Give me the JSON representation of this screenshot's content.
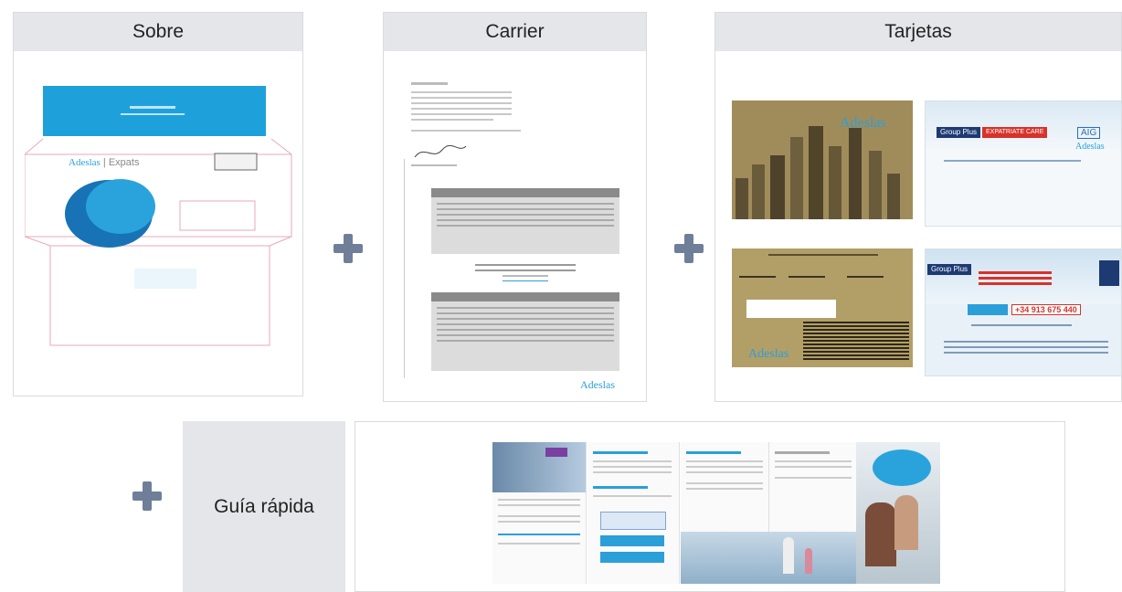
{
  "panels": {
    "sobre": {
      "title": "Sobre"
    },
    "carrier": {
      "title": "Carrier"
    },
    "tarjetas": {
      "title": "Tarjetas"
    }
  },
  "guia": {
    "label": "Guía rápida"
  },
  "sobre_content": {
    "brand": "Adeslas",
    "brand_suffix": "Expats"
  },
  "carrier_content": {
    "brand": "Adeslas"
  },
  "tarjetas_content": {
    "brand": "Adeslas",
    "aig_logo": "AIG",
    "aig_brand": "Adeslas",
    "group_plus": "Group Plus",
    "expatriate_care": "EXPATRIATE CARE",
    "phone": "+34 913 675 440"
  },
  "colors": {
    "panel_header_bg": "#e4e6e9",
    "plus_color": "#6f7f98",
    "envelope_blue": "#1ea1da",
    "card_gold": "#a08c5b",
    "accent_red": "#d6332b"
  }
}
